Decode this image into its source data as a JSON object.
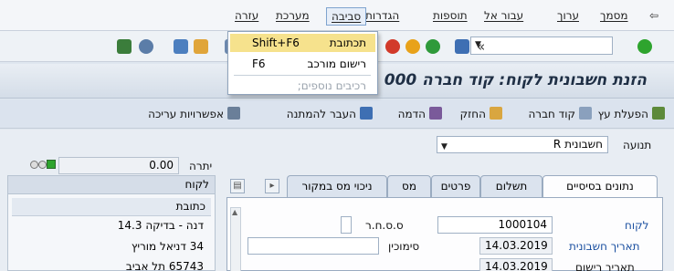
{
  "menubar": {
    "items": [
      "מסמך",
      "ערוך",
      "עבור אל",
      "תוספות",
      "הגדרות",
      "סביבה",
      "מערכת",
      "עזרה"
    ]
  },
  "dropdown": {
    "items": [
      {
        "label": "תכתובת",
        "shortcut": "Shift+F6"
      },
      {
        "label": "רישום מורכב",
        "shortcut": "F6"
      },
      {
        "label": "רכיבים נוספים;",
        "shortcut": ""
      }
    ]
  },
  "title": "הזנת חשבונית לקוח: קוד חברה 000",
  "apptoolbar": {
    "items": [
      "הפעלת עץ",
      "קוד חברה",
      "החזק",
      "הדמה",
      "העבר להמתנה",
      "אפשרויות עריכה"
    ]
  },
  "transaction": {
    "label": "תנועה",
    "value": "R חשבונית"
  },
  "balance": {
    "label": "יתרה",
    "value": "0.00"
  },
  "left_panel": {
    "header": "לקוח",
    "sub_header": "כתובת",
    "lines": [
      "דנה - בדיקה 14.3",
      "34 דניאל מוריץ",
      "65743 תל אביב"
    ]
  },
  "tabs": [
    "נתונים בסיסיים",
    "תשלום",
    "פרטים",
    "מס",
    "ניכוי מס במקור"
  ],
  "form": {
    "customer_label": "לקוח",
    "customer_value": "1000104",
    "invoice_date_label": "תאריך חשבונית",
    "invoice_date_value": "14.03.2019",
    "posting_date_label": "תאריך רישום",
    "posting_date_value": "14.03.2019",
    "ssnr_label": "ס.ס.ח.ר",
    "reference_label": "סימוכין"
  },
  "colors": {
    "accent_blue": "#1a4fa0",
    "highlight_yellow": "#f6e28d",
    "status_green": "#2ea42e"
  }
}
